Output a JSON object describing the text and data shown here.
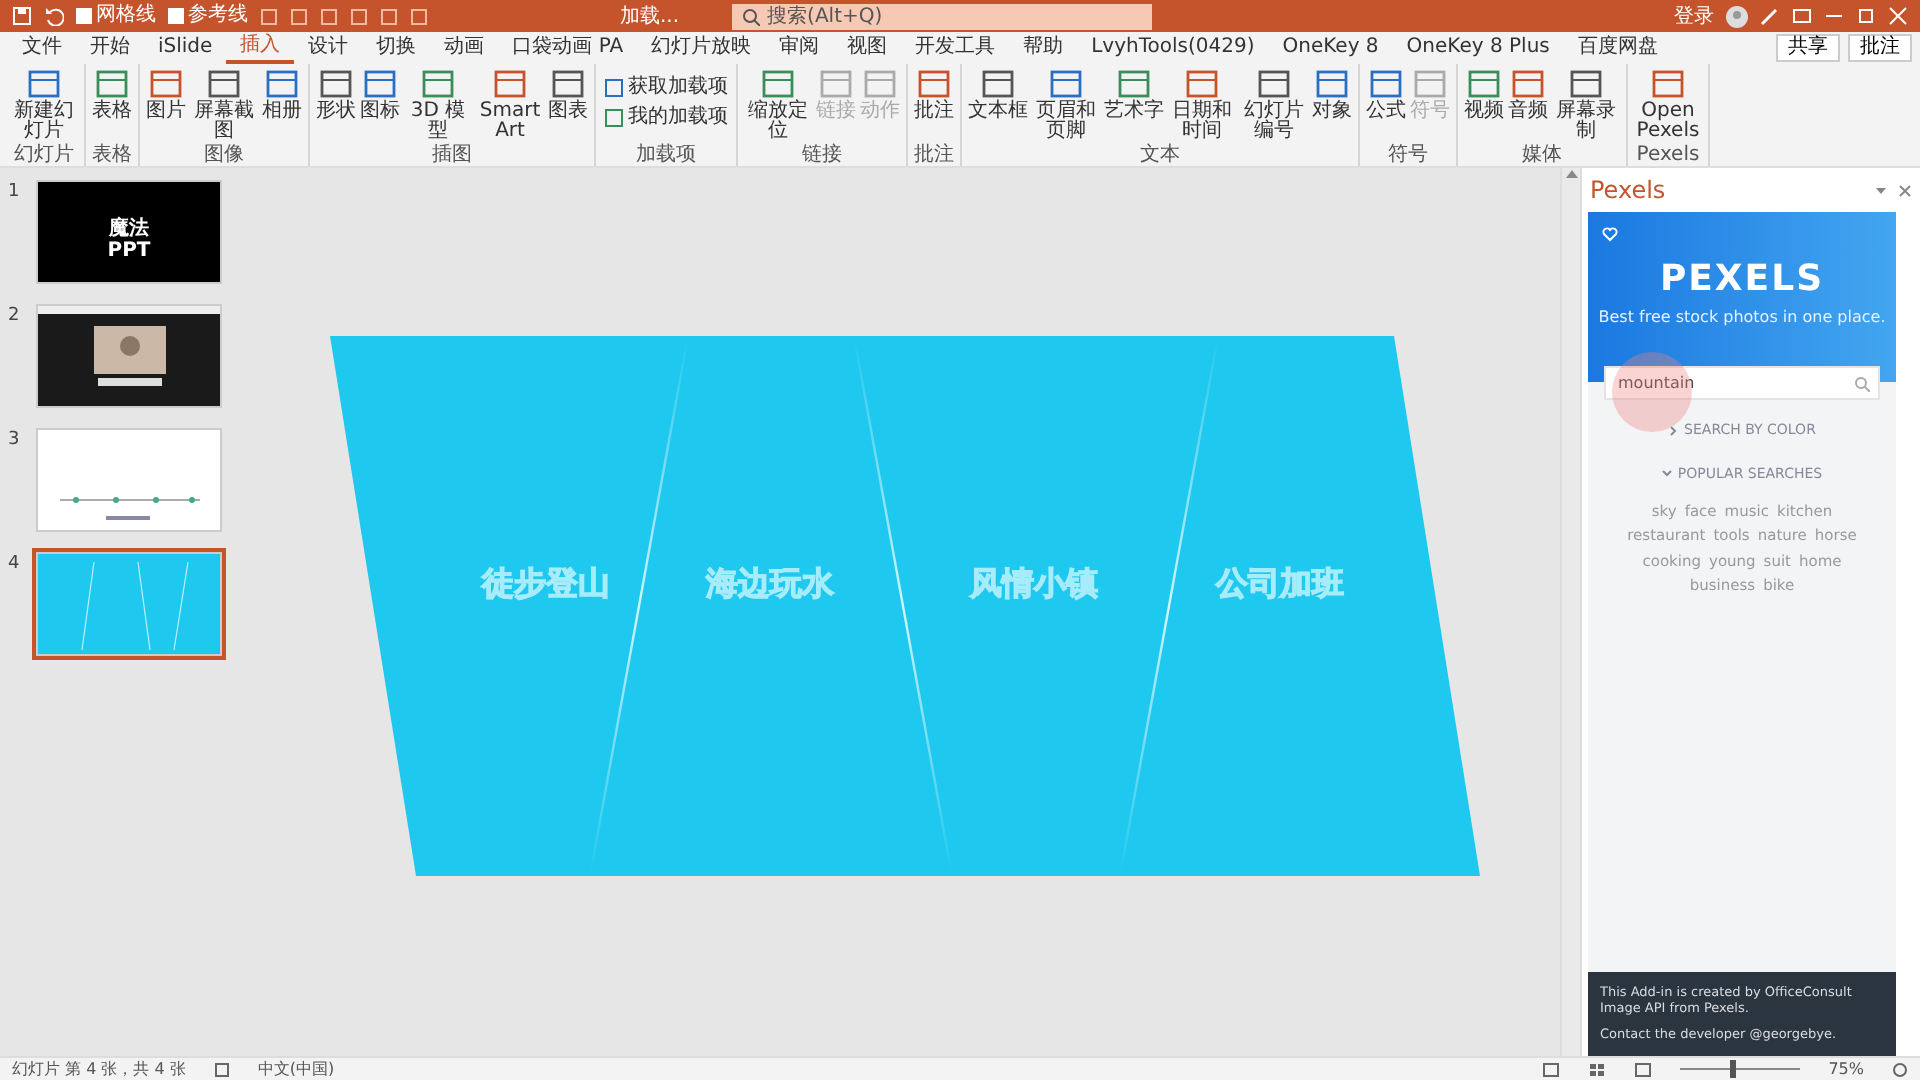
{
  "title_bar": {
    "quick_access": [
      {
        "label": "网格线",
        "checked": false
      },
      {
        "label": "参考线",
        "checked": false
      }
    ],
    "document_title": "加载... ",
    "search_placeholder": "搜索(Alt+Q)",
    "account": "登录"
  },
  "tabs": [
    {
      "label": "文件",
      "selected": false
    },
    {
      "label": "开始",
      "selected": false
    },
    {
      "label": "iSlide",
      "selected": false
    },
    {
      "label": "插入",
      "selected": true
    },
    {
      "label": "设计",
      "selected": false
    },
    {
      "label": "切换",
      "selected": false
    },
    {
      "label": "动画",
      "selected": false
    },
    {
      "label": "口袋动画 PA",
      "selected": false
    },
    {
      "label": "幻灯片放映",
      "selected": false
    },
    {
      "label": "审阅",
      "selected": false
    },
    {
      "label": "视图",
      "selected": false
    },
    {
      "label": "开发工具",
      "selected": false
    },
    {
      "label": "帮助",
      "selected": false
    },
    {
      "label": "LvyhTools(0429)",
      "selected": false
    },
    {
      "label": "OneKey 8",
      "selected": false
    },
    {
      "label": "OneKey 8 Plus",
      "selected": false
    },
    {
      "label": "百度网盘",
      "selected": false
    }
  ],
  "share_button": "共享",
  "comments_button": "批注",
  "ribbon_groups": [
    {
      "label": "幻灯片",
      "buttons": [
        {
          "label": "新建幻灯片",
          "disabled": false
        }
      ]
    },
    {
      "label": "表格",
      "buttons": [
        {
          "label": "表格",
          "disabled": false
        }
      ]
    },
    {
      "label": "图像",
      "buttons": [
        {
          "label": "图片",
          "disabled": false
        },
        {
          "label": "屏幕截图",
          "disabled": false
        },
        {
          "label": "相册",
          "disabled": false
        }
      ]
    },
    {
      "label": "插图",
      "buttons": [
        {
          "label": "形状",
          "disabled": false
        },
        {
          "label": "图标",
          "disabled": false
        },
        {
          "label": "3D 模型",
          "disabled": false
        },
        {
          "label": "SmartArt",
          "disabled": false
        },
        {
          "label": "图表",
          "disabled": false
        }
      ]
    },
    {
      "label": "加载项",
      "kind": "stack",
      "buttons": [
        {
          "label": "获取加载项",
          "disabled": false
        },
        {
          "label": "我的加载项",
          "disabled": false
        }
      ]
    },
    {
      "label": "链接",
      "buttons": [
        {
          "label": "缩放定位",
          "disabled": false
        },
        {
          "label": "链接",
          "disabled": true
        },
        {
          "label": "动作",
          "disabled": true
        }
      ]
    },
    {
      "label": "批注",
      "buttons": [
        {
          "label": "批注",
          "disabled": false
        }
      ]
    },
    {
      "label": "文本",
      "buttons": [
        {
          "label": "文本框",
          "disabled": false
        },
        {
          "label": "页眉和页脚",
          "disabled": false
        },
        {
          "label": "艺术字",
          "disabled": false
        },
        {
          "label": "日期和时间",
          "disabled": false
        },
        {
          "label": "幻灯片编号",
          "disabled": false
        },
        {
          "label": "对象",
          "disabled": false
        }
      ]
    },
    {
      "label": "符号",
      "buttons": [
        {
          "label": "公式",
          "disabled": false
        },
        {
          "label": "符号",
          "disabled": true
        }
      ]
    },
    {
      "label": "媒体",
      "buttons": [
        {
          "label": "视频",
          "disabled": false
        },
        {
          "label": "音频",
          "disabled": false
        },
        {
          "label": "屏幕录制",
          "disabled": false
        }
      ]
    },
    {
      "label": "Pexels",
      "buttons": [
        {
          "label": "Open Pexels",
          "disabled": false
        }
      ]
    }
  ],
  "slides": [
    {
      "number": "1",
      "kind": "title",
      "texts": [
        "魔法",
        "PPT"
      ],
      "selected": false
    },
    {
      "number": "2",
      "selected": false
    },
    {
      "number": "3",
      "kind": "timeline",
      "selected": false
    },
    {
      "number": "4",
      "kind": "panels",
      "selected": true
    }
  ],
  "slide": {
    "texts": [
      "徒步登山",
      "海边玩水",
      "风情小镇",
      "公司加班"
    ]
  },
  "pexels_pane": {
    "title": "Pexels",
    "logo": "PEXELS",
    "tagline": "Best free stock photos in one place.",
    "search_value": "mountain",
    "sections": [
      {
        "label": "SEARCH BY COLOR",
        "expanded": false
      },
      {
        "label": "POPULAR SEARCHES",
        "expanded": true
      }
    ],
    "popular": [
      "sky",
      "face",
      "music",
      "kitchen",
      "restaurant",
      "tools",
      "nature",
      "horse",
      "cooking",
      "young",
      "suit",
      "home",
      "business",
      "bike"
    ],
    "footer": [
      "This Add-in is created by OfficeConsult",
      "Image API from Pexels.",
      "Contact the developer @georgebye."
    ]
  },
  "status_bar": {
    "slide_info": "幻灯片 第 4 张，共 4 张",
    "language": "中文(中国)",
    "zoom": {
      "level": 0.42,
      "reading": "75%"
    }
  }
}
